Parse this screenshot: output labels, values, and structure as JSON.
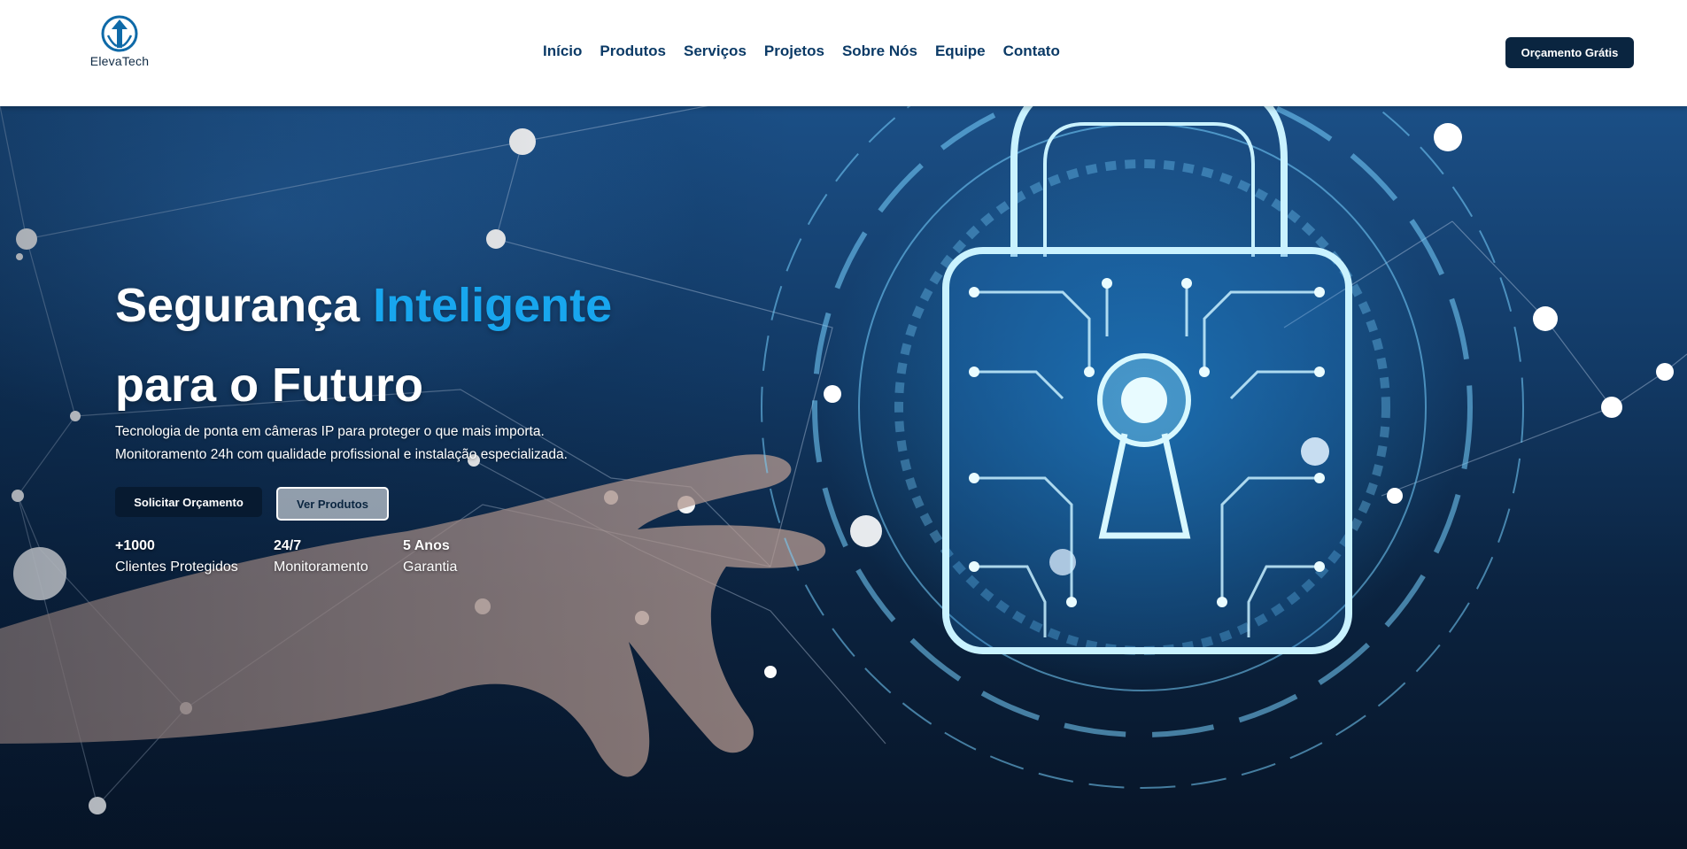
{
  "brand": {
    "name": "ElevaTech",
    "logo_icon": "shield-arrow-icon",
    "color": "#0f6aa8"
  },
  "nav": {
    "items": [
      {
        "label": "Início"
      },
      {
        "label": "Produtos"
      },
      {
        "label": "Serviços"
      },
      {
        "label": "Projetos"
      },
      {
        "label": "Sobre Nós"
      },
      {
        "label": "Equipe"
      },
      {
        "label": "Contato"
      }
    ],
    "cta_label": "Orçamento Grátis"
  },
  "hero": {
    "title_part1": "Segurança ",
    "title_accent": "Inteligente",
    "title_part2": "para o Futuro",
    "subtitle_line1": "Tecnologia de ponta em câmeras IP para proteger o que mais importa.",
    "subtitle_line2": "Monitoramento 24h com qualidade profissional e instalação especializada.",
    "primary_button": "Solicitar Orçamento",
    "secondary_button": "Ver Produtos",
    "background_icon": "digital-padlock-icon",
    "stats": [
      {
        "value": "+1000",
        "label": "Clientes Protegidos"
      },
      {
        "value": "24/7",
        "label": "Monitoramento"
      },
      {
        "value": "5 Anos",
        "label": "Garantia"
      }
    ]
  },
  "colors": {
    "accent": "#18a6ee",
    "dark": "#0a2540",
    "nav_text": "#0b3a66"
  }
}
